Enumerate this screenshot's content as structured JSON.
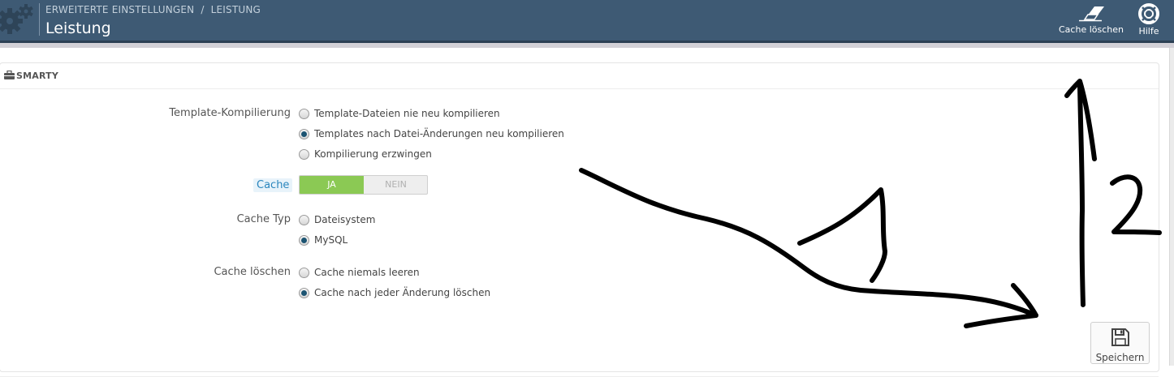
{
  "header": {
    "breadcrumb": [
      "ERWEITERTE EINSTELLUNGEN",
      "LEISTUNG"
    ],
    "breadcrumb_sep": "/",
    "title": "Leistung",
    "toolbar": {
      "clear_cache": "Cache löschen",
      "help": "Hilfe"
    }
  },
  "panel": {
    "title": "SMARTY",
    "fields": {
      "template_compilation": {
        "label": "Template-Kompilierung",
        "options": [
          {
            "label": "Template-Dateien nie neu kompilieren",
            "checked": false
          },
          {
            "label": "Templates nach Datei-Änderungen neu kompilieren",
            "checked": true
          },
          {
            "label": "Kompilierung erzwingen",
            "checked": false
          }
        ]
      },
      "cache": {
        "label": "Cache",
        "on_label": "JA",
        "off_label": "NEIN",
        "value": "JA"
      },
      "cache_type": {
        "label": "Cache Typ",
        "options": [
          {
            "label": "Dateisystem",
            "checked": false
          },
          {
            "label": "MySQL",
            "checked": true
          }
        ]
      },
      "clear_cache": {
        "label": "Cache löschen",
        "options": [
          {
            "label": "Cache niemals leeren",
            "checked": false
          },
          {
            "label": "Cache nach jeder Änderung löschen",
            "checked": true
          }
        ]
      }
    },
    "save_label": "Speichern"
  },
  "annotations": {
    "label_1": "1",
    "label_2": "2",
    "ink_color": "#000000"
  },
  "colors": {
    "header_bg": "#3e5a74",
    "switch_on": "#8bc954",
    "radio_checked": "#1c5472",
    "cache_label": "#2a86bd"
  }
}
